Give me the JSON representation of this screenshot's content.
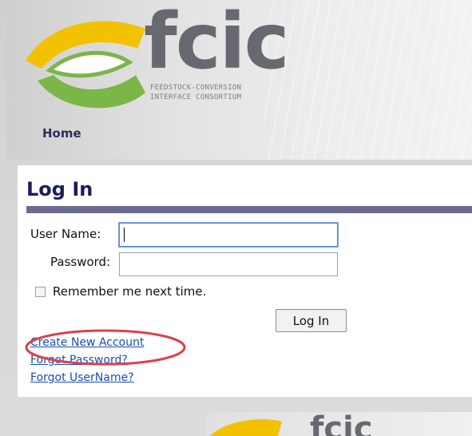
{
  "brand": {
    "name": "fcic",
    "tagline_line1": "FEEDSTOCK-CONVERSION",
    "tagline_line2": "INTERFACE CONSORTIUM",
    "colors": {
      "yellow": "#f2c200",
      "green": "#7ab648",
      "gray": "#666a70"
    }
  },
  "nav": {
    "home_label": "Home"
  },
  "login": {
    "title": "Log In",
    "username_label": "User Name:",
    "password_label": "Password:",
    "username_value": "",
    "password_value": "",
    "remember_label": "Remember me next time.",
    "remember_checked": false,
    "submit_label": "Log In",
    "links": {
      "create_account": "Create New Account",
      "forgot_password": "Forgot Password?",
      "forgot_username": "Forgot UserName?"
    },
    "accent_color": "#6b6a8f"
  },
  "annotation": {
    "highlight_color": "#d9434b"
  }
}
